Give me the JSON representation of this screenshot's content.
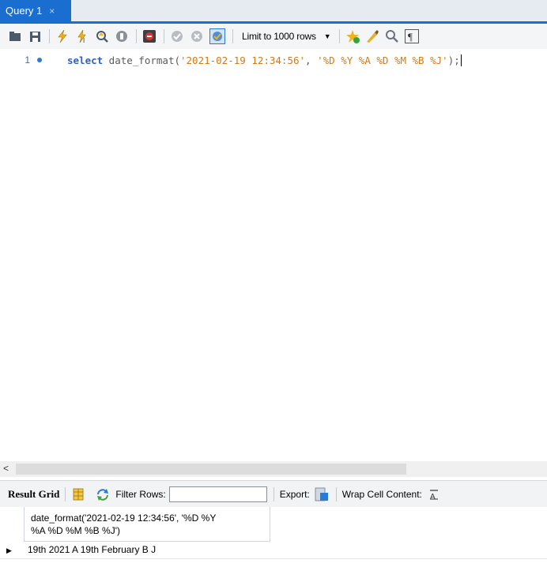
{
  "tab": {
    "title": "Query 1",
    "close": "×"
  },
  "toolbar": {
    "limit_label": "Limit to 1000 rows",
    "icons": [
      "open-folder-icon",
      "save-icon",
      "execute-icon",
      "execute-current-icon",
      "explain-icon",
      "stop-icon",
      "toggle-error-icon",
      "commit-icon",
      "rollback-icon",
      "autocommit-icon",
      "add-snippet-icon",
      "beautify-icon",
      "find-icon",
      "invisible-chars-icon"
    ]
  },
  "editor": {
    "line_number": "1",
    "keyword": "select",
    "function_open": " date_format(",
    "arg1": "'2021-02-19 12:34:56'",
    "comma": ", ",
    "arg2": "'%D %Y %A %D %M %B %J'",
    "close": ");"
  },
  "result_toolbar": {
    "result_grid": "Result Grid",
    "filter_rows": "Filter Rows:",
    "export": "Export:",
    "wrap": "Wrap Cell Content:"
  },
  "grid": {
    "column_header_line1": "date_format('2021-02-19 12:34:56', '%D %Y",
    "column_header_line2": "%A %D %M %B %J')",
    "rows": [
      {
        "value": "19th 2021 A 19th February B J"
      }
    ]
  },
  "colors": {
    "accent": "#1a6ecf",
    "keyword": "#2c62c7",
    "string": "#d07a1c"
  }
}
